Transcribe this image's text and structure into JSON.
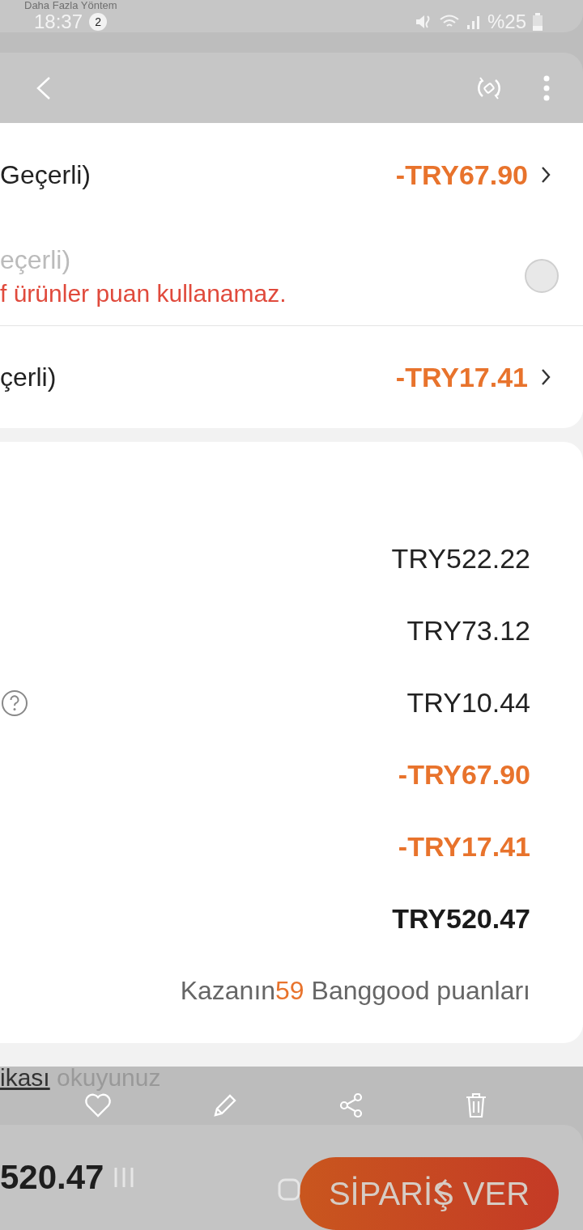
{
  "top_title": "Daha Fazla Yöntem",
  "status_bar": {
    "time": "18:37",
    "notification_count": "2",
    "battery": "%25"
  },
  "discount_rows": [
    {
      "kind": "value",
      "label": "Geçerli)",
      "amount": "-TRY67.90"
    },
    {
      "kind": "toggle",
      "label": "eçerli)",
      "note": "f ürünler puan kullanamaz.",
      "selected": false
    },
    {
      "kind": "value",
      "label": "çerli)",
      "amount": "-TRY17.41"
    }
  ],
  "summary": [
    {
      "amount": "TRY522.22",
      "kind": "normal",
      "help": false
    },
    {
      "amount": "TRY73.12",
      "kind": "normal",
      "help": false
    },
    {
      "amount": "TRY10.44",
      "kind": "normal",
      "help": true
    },
    {
      "amount": "-TRY67.90",
      "kind": "discount",
      "help": false
    },
    {
      "amount": "-TRY17.41",
      "kind": "discount",
      "help": false
    },
    {
      "amount": "TRY520.47",
      "kind": "total",
      "help": false
    }
  ],
  "points": {
    "prefix": "Kazanın",
    "value": "59",
    "suffix": "Banggood puanları"
  },
  "policy": {
    "link": "ikası",
    "text": "okuyunuz"
  },
  "footer": {
    "total": "520.47",
    "button": "SİPARİŞ VER"
  }
}
